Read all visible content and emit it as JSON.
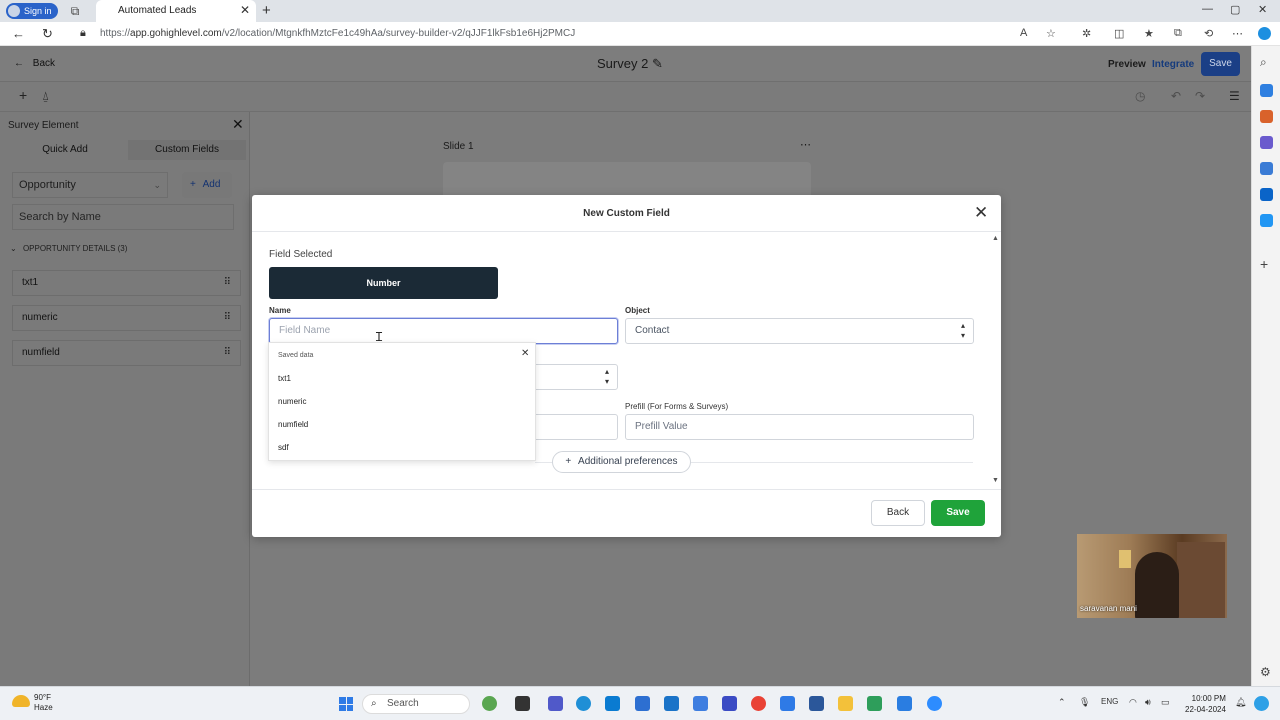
{
  "browser": {
    "signin_label": "Sign in",
    "tab_title": "Automated Leads",
    "url_prefix": "https://",
    "url_host": "app.gohighlevel.com",
    "url_path": "/v2/location/MtgnkfhMztcFe1c49hAa/survey-builder-v2/qJJF1lkFsb1e6Hj2PMCJ"
  },
  "header": {
    "back_label": "Back",
    "survey_title": "Survey 2",
    "preview_label": "Preview",
    "integrate_label": "Integrate",
    "save_label": "Save"
  },
  "sidebar": {
    "title": "Survey Element",
    "tabs": [
      {
        "label": "Quick Add"
      },
      {
        "label": "Custom Fields"
      }
    ],
    "object_select": "Opportunity",
    "add_label": "Add",
    "search_placeholder": "Search by Name",
    "section_label": "OPPORTUNITY DETAILS (3)",
    "items": [
      {
        "label": "txt1"
      },
      {
        "label": "numeric"
      },
      {
        "label": "numfield"
      }
    ]
  },
  "canvas": {
    "slide_label": "Slide 1"
  },
  "modal": {
    "title": "New Custom Field",
    "field_selected_label": "Field Selected",
    "field_type": "Number",
    "name_label": "Name",
    "name_placeholder": "Field Name",
    "object_label": "Object",
    "object_value": "Contact",
    "prefill_label": "Prefill (For Forms & Surveys)",
    "prefill_placeholder": "Prefill Value",
    "additional_preferences_label": "Additional preferences",
    "back_label": "Back",
    "save_label": "Save"
  },
  "autocomplete": {
    "header": "Saved data",
    "items": [
      "txt1",
      "numeric",
      "numfield",
      "sdf"
    ]
  },
  "webcam": {
    "participant_name": "saravanan mani"
  },
  "taskbar": {
    "temperature": "90°F",
    "condition": "Haze",
    "search_label": "Search",
    "language": "ENG",
    "time": "10:00 PM",
    "date": "22-04-2024"
  },
  "colors": {
    "primary_blue": "#1b3f86",
    "save_green": "#1fa33a",
    "chip_dark": "#1b2a36",
    "focus_border": "#6d7fd6"
  }
}
